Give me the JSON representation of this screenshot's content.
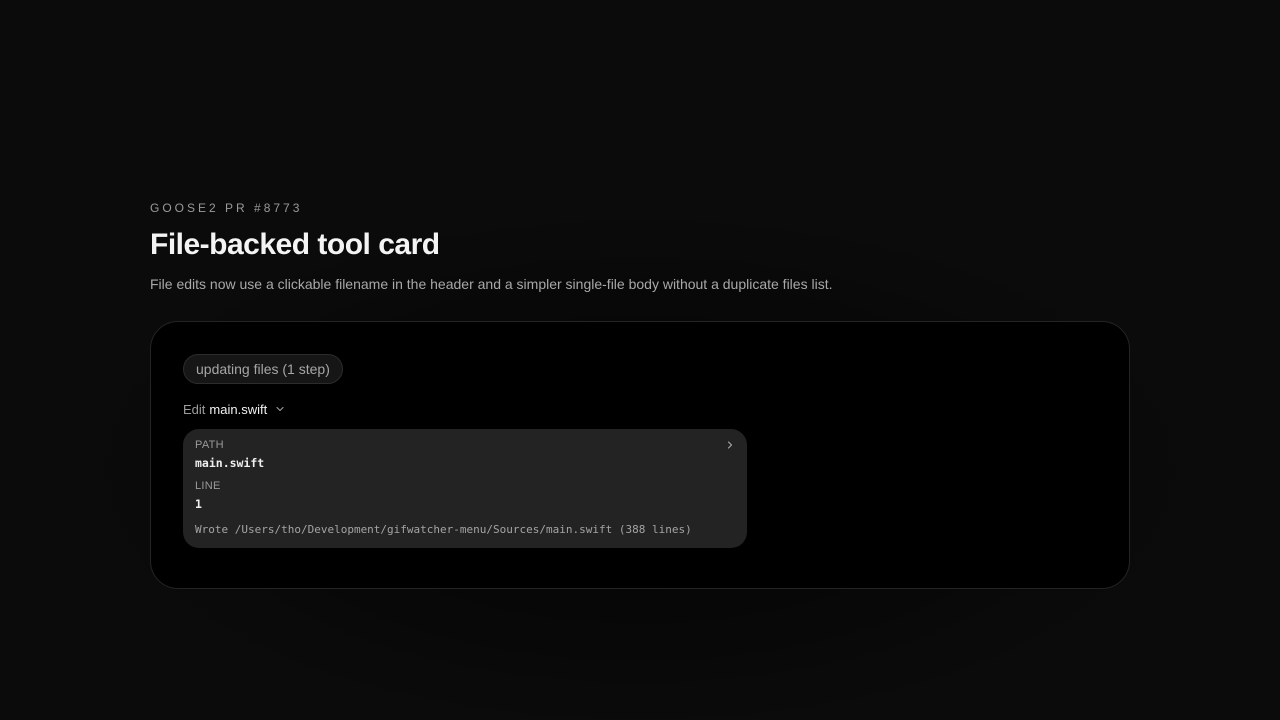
{
  "header": {
    "eyebrow": "GOOSE2 PR #8773",
    "title": "File-backed tool card",
    "subtitle": "File edits now use a clickable filename in the header and a simpler single-file body without a duplicate files list."
  },
  "panel": {
    "status_chip": "updating files (1 step)",
    "edit": {
      "verb": "Edit",
      "filename": "main.swift",
      "chevron_icon": "chevron-down-icon"
    },
    "tool_card": {
      "path_label": "PATH",
      "path_value": "main.swift",
      "line_label": "LINE",
      "line_value": "1",
      "result": "Wrote /Users/tho/Development/gifwatcher-menu/Sources/main.swift (388 lines)",
      "expand_icon": "chevron-right-icon"
    }
  },
  "colors": {
    "background": "#0a0a0a",
    "panel": "#000000",
    "card": "#232323",
    "text_primary": "#f4f4f4",
    "text_muted": "#a8a8a8"
  }
}
